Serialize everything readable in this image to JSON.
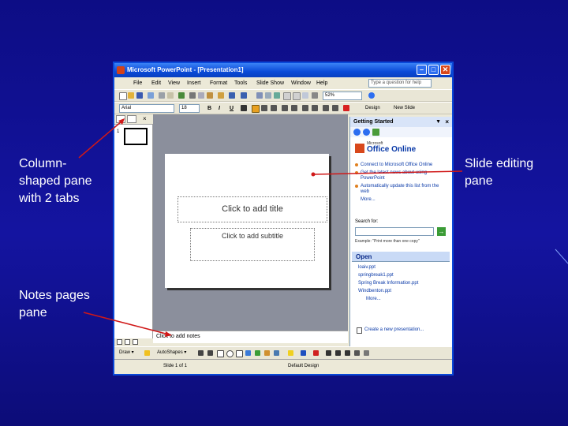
{
  "callouts": {
    "column_pane": "Column-\nshaped pane\nwith 2 tabs",
    "notes_pane": "Notes pages\npane",
    "slide_pane": "Slide editing\npane"
  },
  "window": {
    "title": "Microsoft PowerPoint - [Presentation1]",
    "controls": {
      "minimize": "–",
      "maximize": "□",
      "close": "✕"
    }
  },
  "menu": {
    "items": [
      "File",
      "Edit",
      "View",
      "Insert",
      "Format",
      "Tools",
      "Slide Show",
      "Window",
      "Help"
    ],
    "help_placeholder": "Type a question for help"
  },
  "toolbar": {
    "zoom": "52%",
    "font": "Arial",
    "font_size": "18",
    "bold": "B",
    "italic": "I",
    "underline": "U",
    "design": "Design",
    "new_slide": "New Slide"
  },
  "outline_pane": {
    "slide_number": "1",
    "close": "×"
  },
  "slide": {
    "title_placeholder": "Click to add title",
    "subtitle_placeholder": "Click to add subtitle"
  },
  "notes": {
    "placeholder": "Click to add notes"
  },
  "task_pane": {
    "title": "Getting Started",
    "dropdown": "▼",
    "close": "×",
    "office_online_ms": "Microsoft",
    "office_online": "Office Online",
    "links": [
      "Connect to Microsoft Office Online",
      "Get the latest news about using PowerPoint",
      "Automatically update this list from the web"
    ],
    "more": "More...",
    "search_label": "Search for:",
    "search_go": "→",
    "search_example": "Example: \"Print more than one copy\"",
    "open_header": "Open",
    "open_files": [
      "loaiv.ppt",
      "springbreak1.ppt",
      "Spring Break Information.ppt",
      "Windbenton.ppt"
    ],
    "open_more": "More...",
    "create_new": "Create a new presentation..."
  },
  "draw_toolbar": {
    "draw": "Draw ▾",
    "autoshapes": "AutoShapes ▾"
  },
  "status": {
    "slide": "Slide 1 of 1",
    "design": "Default Design"
  },
  "colors": {
    "background": "#10107a",
    "title_bar": "#0a4ad8",
    "arrow": "#d01818"
  }
}
